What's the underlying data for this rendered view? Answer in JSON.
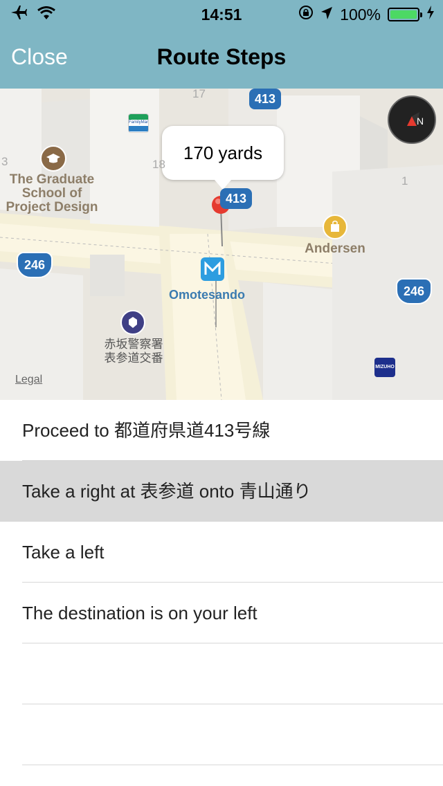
{
  "status_bar": {
    "time": "14:51",
    "battery": "100%"
  },
  "navbar": {
    "close_label": "Close",
    "title": "Route Steps"
  },
  "map": {
    "callout": "170 yards",
    "poi_school": "The Graduate\nSchool of\nProject Design",
    "poi_andersen": "Andersen",
    "station": "Omotesando",
    "police_box": "赤坂警察署\n表参道交番",
    "legal": "Legal",
    "route_413_a": "413",
    "route_413_b": "413",
    "route_246_a": "246",
    "route_246_b": "246",
    "num_17": "17",
    "num_18": "18",
    "num_3": "3",
    "num_1": "1",
    "mizuho": "MIZUHO",
    "familymart": "FamilyMart"
  },
  "steps": [
    {
      "text": "Proceed to 都道府県道413号線",
      "selected": false
    },
    {
      "text": "Take a right at 表参道 onto 青山通り",
      "selected": true
    },
    {
      "text": "Take a left",
      "selected": false
    },
    {
      "text": "The destination is on your left",
      "selected": false
    },
    {
      "text": "",
      "selected": false
    },
    {
      "text": "",
      "selected": false
    }
  ]
}
